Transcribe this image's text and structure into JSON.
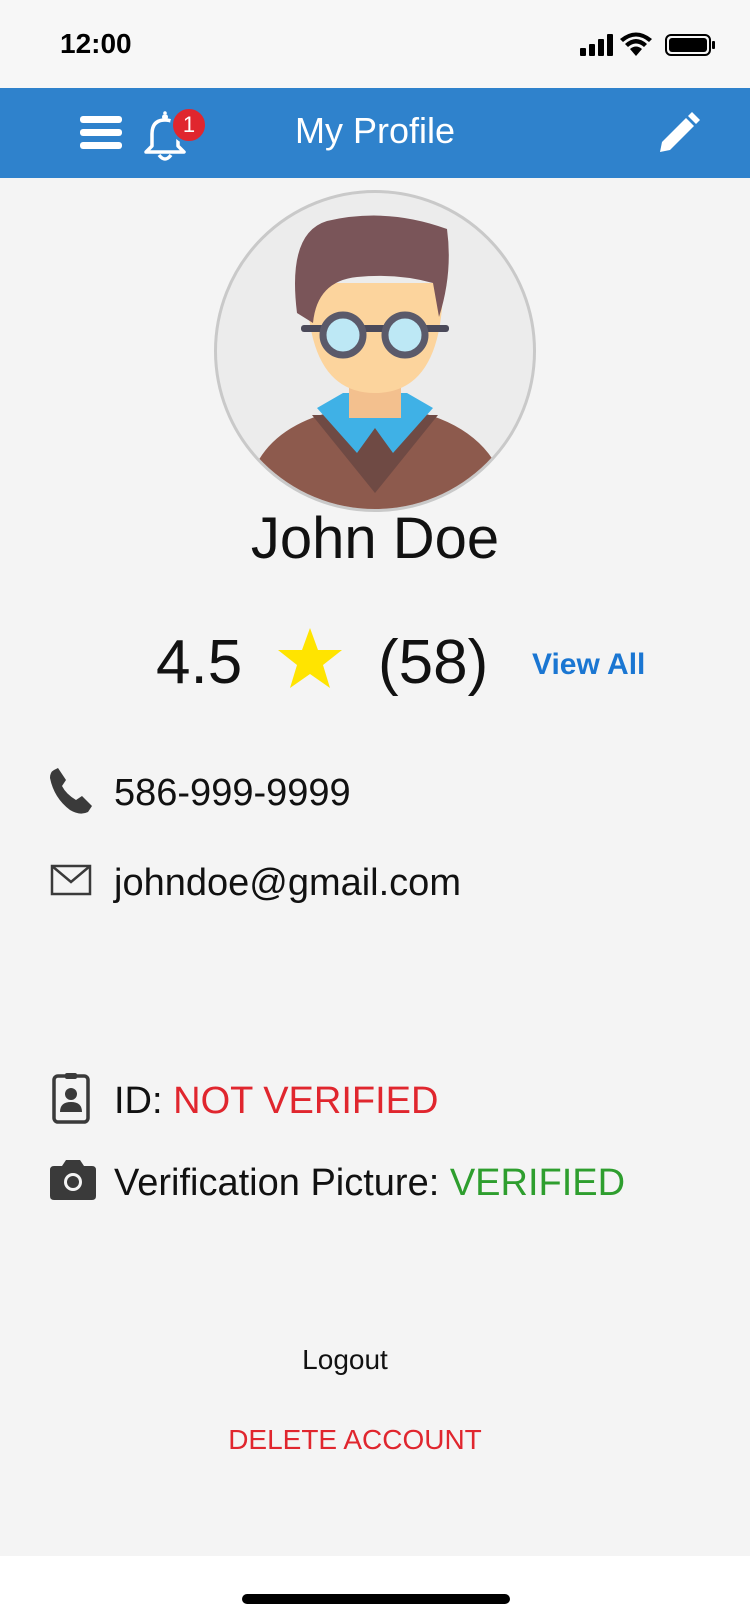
{
  "status_bar": {
    "time": "12:00"
  },
  "header": {
    "title": "My Profile",
    "notification_count": "1"
  },
  "profile": {
    "name": "John Doe"
  },
  "rating": {
    "value": "4.5",
    "count": "(58)",
    "view_all_label": "View All",
    "star_color": "#ffe400"
  },
  "contact": {
    "phone": "586-999-9999",
    "email": "johndoe@gmail.com"
  },
  "verification": {
    "id_label": "ID: ",
    "id_status": "NOT VERIFIED",
    "picture_label": "Verification Picture: ",
    "picture_status": "VERIFIED"
  },
  "actions": {
    "logout_label": "Logout",
    "delete_label": "DELETE ACCOUNT"
  },
  "colors": {
    "header_bg": "#2f82cc",
    "danger": "#e0262e",
    "success": "#2e9e2e",
    "link": "#1a76d2"
  }
}
